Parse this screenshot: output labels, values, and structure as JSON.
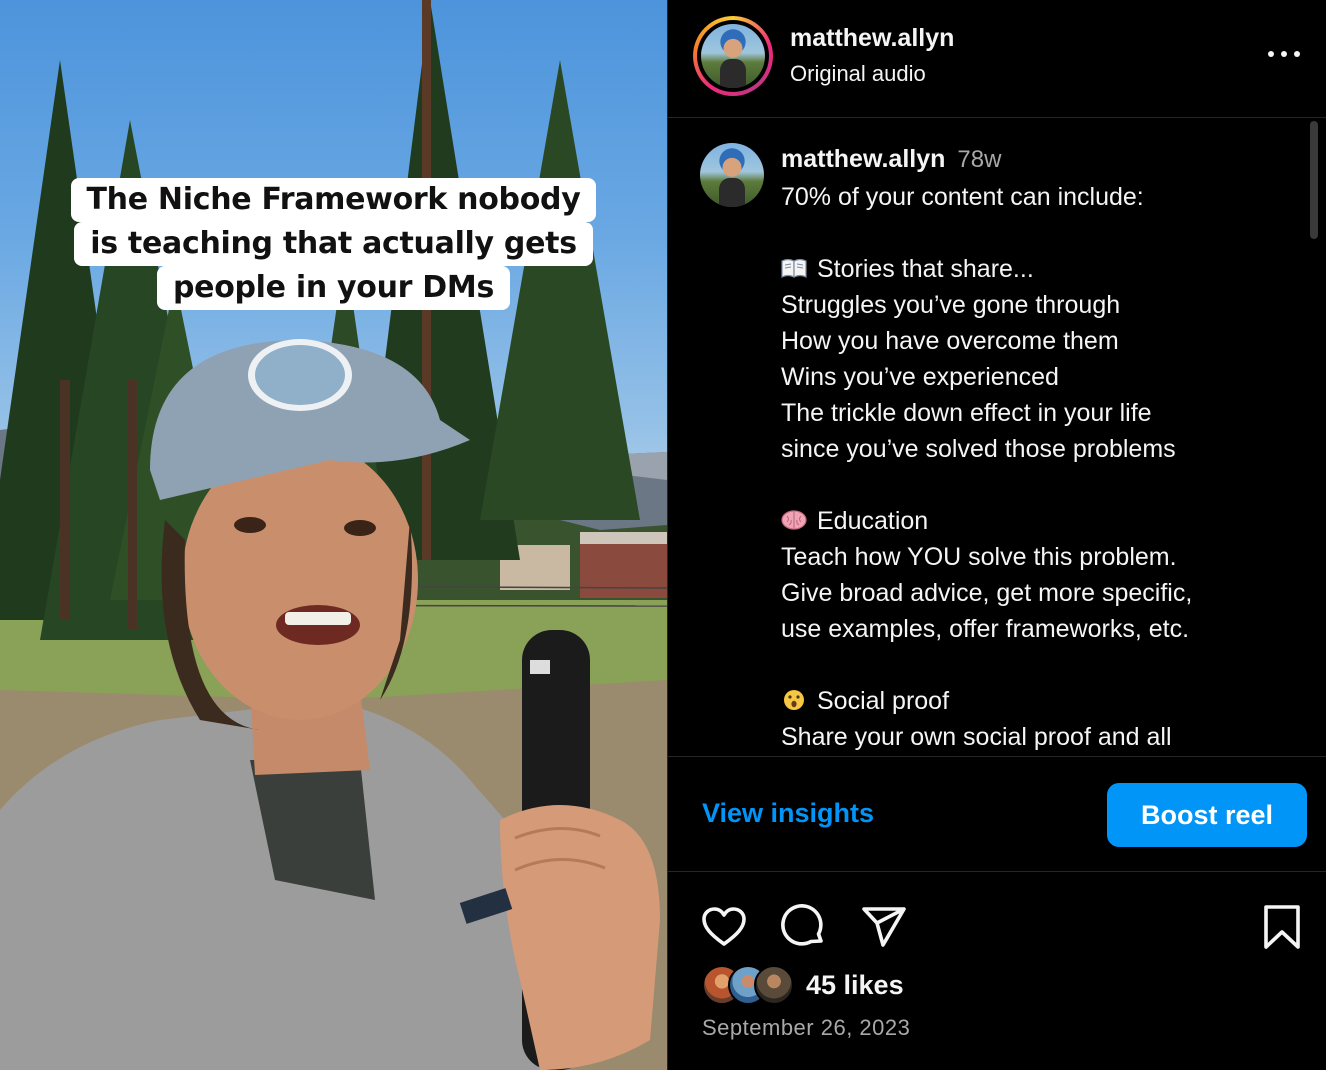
{
  "video": {
    "overlay_lines": [
      "The Niche Framework nobody",
      "is teaching that actually gets",
      "people in your DMs"
    ]
  },
  "header": {
    "username": "matthew.allyn",
    "subtitle": "Original audio",
    "more_icon": "more-horizontal-icon"
  },
  "caption": {
    "username": "matthew.allyn",
    "time": "78w",
    "lines": [
      {
        "text": "70% of your content can include:",
        "emoji": ""
      },
      {
        "text": "",
        "emoji": ""
      },
      {
        "text": "Stories that share...",
        "emoji": "open-book-emoji"
      },
      {
        "text": "Struggles you’ve gone through",
        "emoji": ""
      },
      {
        "text": "How you have overcome them",
        "emoji": ""
      },
      {
        "text": "Wins you’ve experienced",
        "emoji": ""
      },
      {
        "text": "The trickle down effect in your life",
        "emoji": ""
      },
      {
        "text": "since you’ve solved those problems",
        "emoji": ""
      },
      {
        "text": "",
        "emoji": ""
      },
      {
        "text": "Education",
        "emoji": "brain-emoji"
      },
      {
        "text": "Teach how YOU solve this problem.",
        "emoji": ""
      },
      {
        "text": "Give broad advice, get more specific,",
        "emoji": ""
      },
      {
        "text": "use examples, offer frameworks, etc.",
        "emoji": ""
      },
      {
        "text": "",
        "emoji": ""
      },
      {
        "text": "Social proof",
        "emoji": "astonished-face-emoji"
      },
      {
        "text": "Share your own social proof and all",
        "emoji": ""
      }
    ]
  },
  "insights": {
    "view_label": "View insights",
    "boost_label": "Boost reel"
  },
  "actions": {
    "icons": [
      "heart-icon",
      "comment-icon",
      "share-icon",
      "bookmark-icon"
    ],
    "likes": "45 likes",
    "date": "September 26, 2023"
  },
  "colors": {
    "accent": "#0095f6",
    "background": "#000000",
    "secondary_text": "#a8a8a8"
  }
}
